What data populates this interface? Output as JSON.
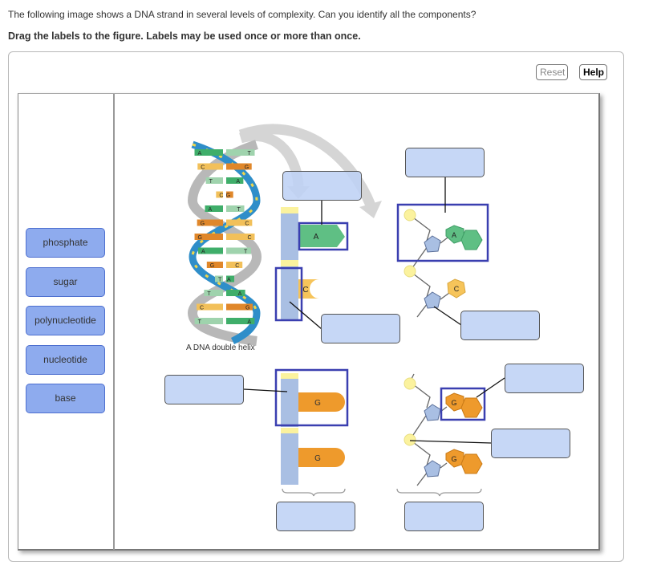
{
  "instructions": {
    "question": "The following image shows a DNA strand in several levels of complexity. Can you identify all the components?",
    "directive": "Drag the labels to the figure. Labels may be used once or more than once."
  },
  "toolbar": {
    "reset_label": "Reset",
    "help_label": "Help"
  },
  "labels": [
    {
      "text": "phosphate"
    },
    {
      "text": "sugar"
    },
    {
      "text": "polynucleotide"
    },
    {
      "text": "nucleotide"
    },
    {
      "text": "base"
    }
  ],
  "figure": {
    "caption": "A DNA double helix",
    "helix_pairs": [
      "A-T",
      "C-G",
      "T-A",
      "C-G",
      "A-T",
      "G-C",
      "G-C",
      "A-T",
      "G-C",
      "T-A",
      "T-A",
      "C-G",
      "T-A"
    ],
    "bases": {
      "strand_top_a": "A",
      "strand_top_c": "C",
      "nucleotide_a": "A",
      "nucleotide_c": "C",
      "strand_bottom_g1": "G",
      "strand_bottom_g2": "G",
      "nucleotide_g1": "G",
      "nucleotide_g2": "G"
    },
    "drop_targets": [
      {
        "id": "target-1"
      },
      {
        "id": "target-2"
      },
      {
        "id": "target-3"
      },
      {
        "id": "target-4"
      },
      {
        "id": "target-5"
      },
      {
        "id": "target-6"
      },
      {
        "id": "target-7"
      },
      {
        "id": "target-8"
      },
      {
        "id": "target-9"
      },
      {
        "id": "target-10"
      }
    ]
  },
  "colors": {
    "label_fill": "#8eabee",
    "target_fill": "#bed1f5",
    "highlight_box": "#3a3fb0",
    "sugar": "#a9bfe3",
    "phosphate": "#fbf29e",
    "adenine": "#5fbf84",
    "cytosine": "#f6c45a",
    "guanine": "#ee9a2c"
  }
}
